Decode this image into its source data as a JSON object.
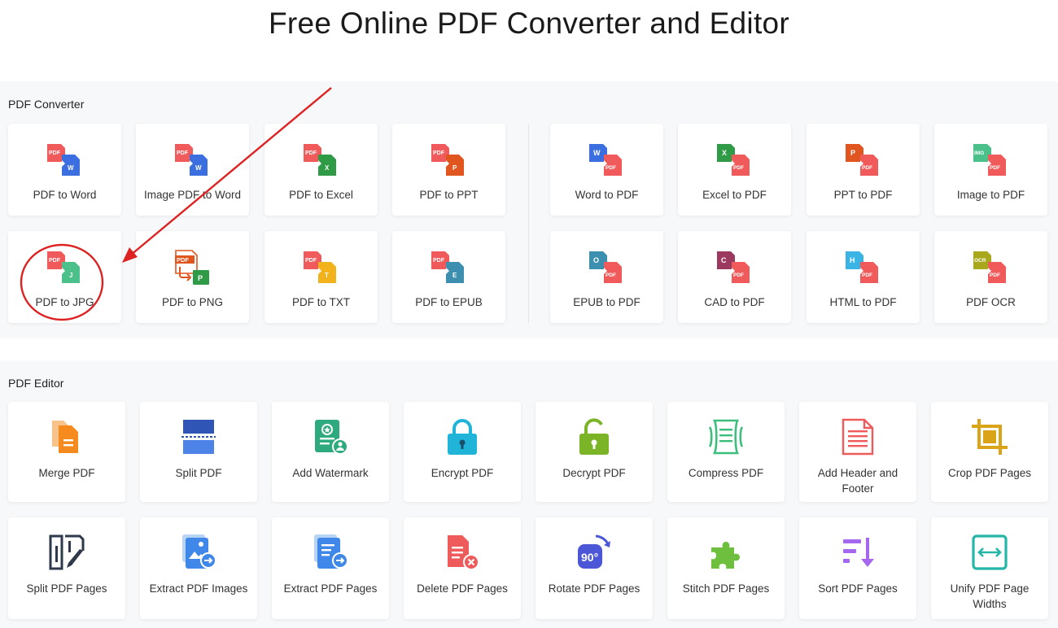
{
  "page": {
    "title": "Free Online PDF Converter and Editor"
  },
  "converter": {
    "label": "PDF Converter",
    "tools": [
      {
        "label": "PDF to Word",
        "icon": "pdf-to-word-icon"
      },
      {
        "label": "Image PDF to Word",
        "icon": "image-pdf-to-word-icon"
      },
      {
        "label": "PDF to Excel",
        "icon": "pdf-to-excel-icon"
      },
      {
        "label": "PDF to PPT",
        "icon": "pdf-to-ppt-icon"
      },
      {
        "label": "Word to PDF",
        "icon": "word-to-pdf-icon"
      },
      {
        "label": "Excel to PDF",
        "icon": "excel-to-pdf-icon"
      },
      {
        "label": "PPT to PDF",
        "icon": "ppt-to-pdf-icon"
      },
      {
        "label": "Image to PDF",
        "icon": "image-to-pdf-icon"
      },
      {
        "label": "PDF to JPG",
        "icon": "pdf-to-jpg-icon"
      },
      {
        "label": "PDF to PNG",
        "icon": "pdf-to-png-icon"
      },
      {
        "label": "PDF to TXT",
        "icon": "pdf-to-txt-icon"
      },
      {
        "label": "PDF to EPUB",
        "icon": "pdf-to-epub-icon"
      },
      {
        "label": "EPUB to PDF",
        "icon": "epub-to-pdf-icon"
      },
      {
        "label": "CAD to PDF",
        "icon": "cad-to-pdf-icon"
      },
      {
        "label": "HTML to PDF",
        "icon": "html-to-pdf-icon"
      },
      {
        "label": "PDF OCR",
        "icon": "pdf-ocr-icon"
      }
    ]
  },
  "editor": {
    "label": "PDF Editor",
    "tools": [
      {
        "label": "Merge PDF",
        "icon": "merge-icon"
      },
      {
        "label": "Split PDF",
        "icon": "split-icon"
      },
      {
        "label": "Add Watermark",
        "icon": "watermark-icon"
      },
      {
        "label": "Encrypt PDF",
        "icon": "lock-icon"
      },
      {
        "label": "Decrypt PDF",
        "icon": "unlock-icon"
      },
      {
        "label": "Compress PDF",
        "icon": "compress-icon"
      },
      {
        "label": "Add Header and Footer",
        "icon": "header-footer-icon"
      },
      {
        "label": "Crop PDF Pages",
        "icon": "crop-icon"
      },
      {
        "label": "Split PDF Pages",
        "icon": "split-pages-icon"
      },
      {
        "label": "Extract PDF Images",
        "icon": "extract-images-icon"
      },
      {
        "label": "Extract PDF Pages",
        "icon": "extract-pages-icon"
      },
      {
        "label": "Delete PDF Pages",
        "icon": "delete-pages-icon"
      },
      {
        "label": "Rotate PDF Pages",
        "icon": "rotate-icon"
      },
      {
        "label": "Stitch PDF Pages",
        "icon": "stitch-icon"
      },
      {
        "label": "Sort PDF Pages",
        "icon": "sort-icon"
      },
      {
        "label": "Unify PDF Page Widths",
        "icon": "unify-widths-icon"
      }
    ]
  },
  "icon_text": {
    "pdf": "PDF",
    "w": "W",
    "x": "X",
    "p": "P",
    "j": "J",
    "t": "T",
    "e": "E",
    "o": "O",
    "c": "C",
    "h": "H",
    "img": "IMG",
    "ocr": "OCR",
    "deg": "90°"
  },
  "colors": {
    "pdf_red": "#f05a5a",
    "word_blue": "#3b6fe0",
    "excel_green": "#2f9b46",
    "ppt_orange": "#e1551f",
    "jpg_green": "#4cc08a",
    "txt_yellow": "#f2b21c",
    "epub_teal": "#3d8fb0",
    "cad_plum": "#9b3a5e",
    "html_cyan": "#3ab4e4",
    "ocr_olive": "#a9a81d",
    "annotation_red": "#dd2222"
  }
}
